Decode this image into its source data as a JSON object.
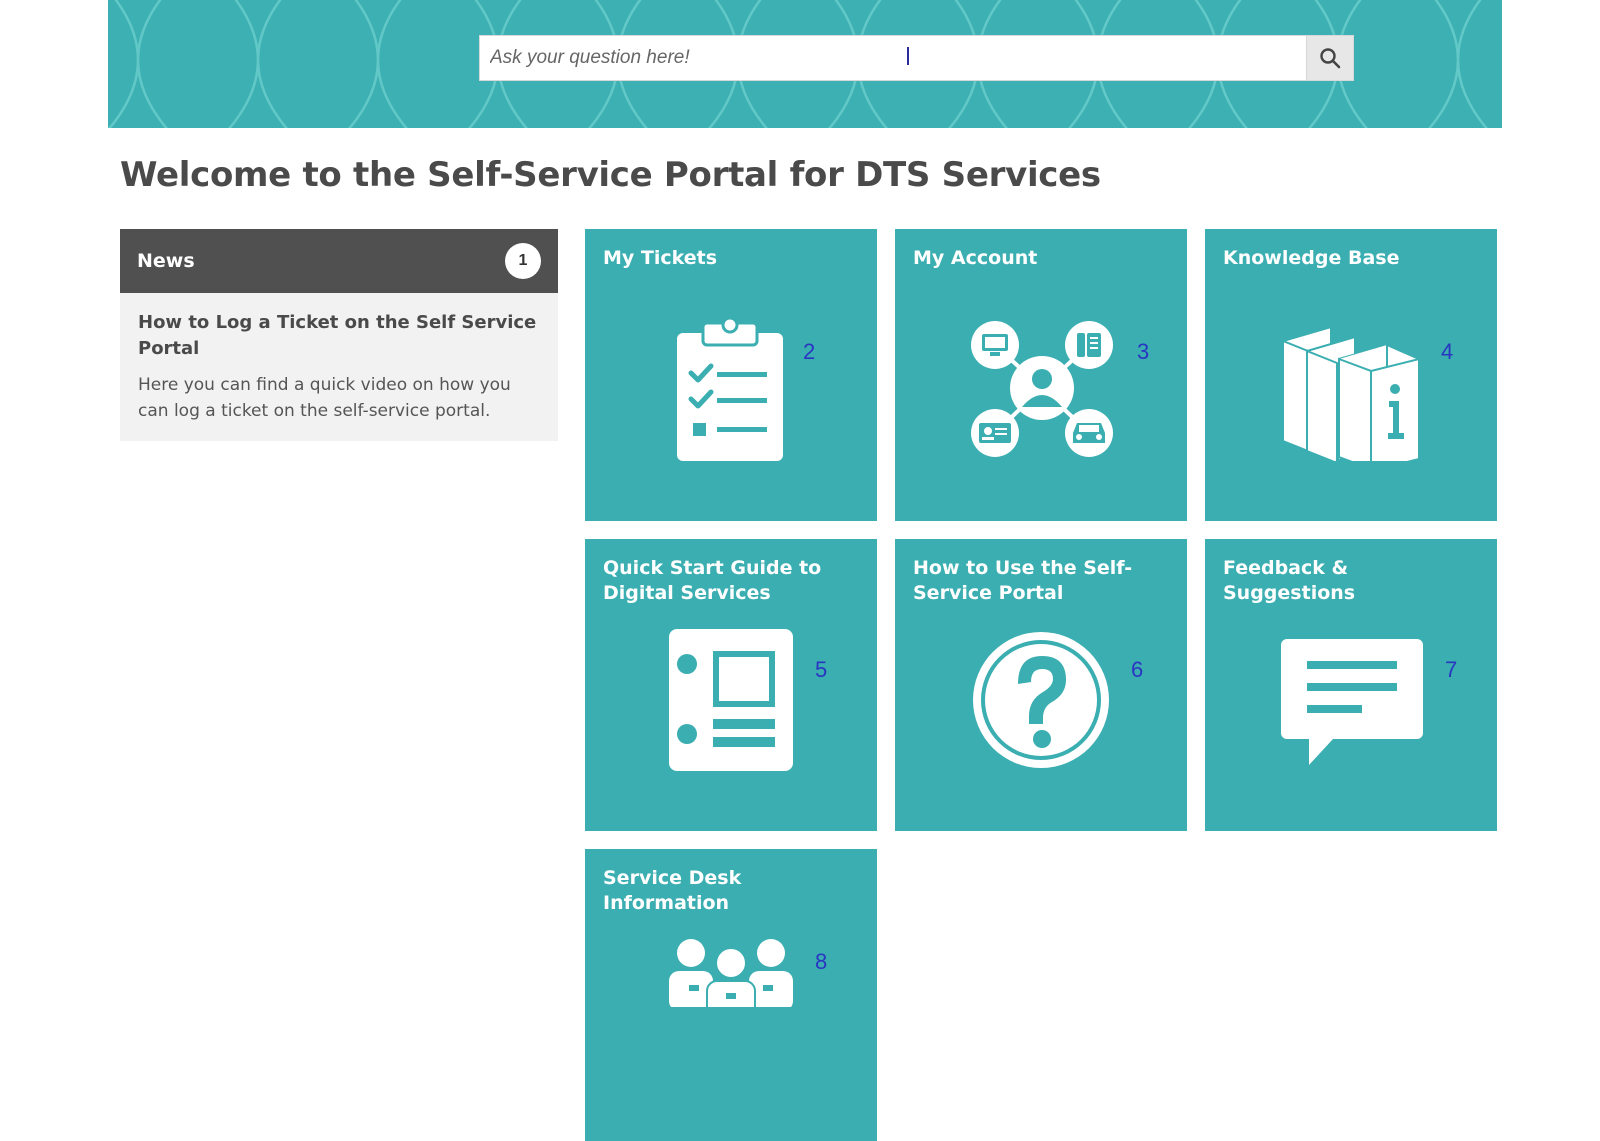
{
  "search": {
    "placeholder": "Ask your question here!"
  },
  "page": {
    "title": "Welcome to the Self-Service Portal for DTS Services"
  },
  "news": {
    "title": "News",
    "count": "1",
    "items": [
      {
        "title": "How to Log a Ticket on the Self Service Portal",
        "description": "Here you can find a quick video on how you can log a ticket on the self-service portal."
      }
    ]
  },
  "tiles": [
    {
      "title": "My Tickets",
      "number": "2",
      "icon": "clipboard-checklist-icon"
    },
    {
      "title": "My Account",
      "number": "3",
      "icon": "account-network-icon"
    },
    {
      "title": "Knowledge Base",
      "number": "4",
      "icon": "info-books-icon"
    },
    {
      "title": "Quick Start Guide to Digital Services",
      "number": "5",
      "icon": "binder-guide-icon"
    },
    {
      "title": "How to Use the Self-Service Portal",
      "number": "6",
      "icon": "question-mark-icon"
    },
    {
      "title": "Feedback & Suggestions",
      "number": "7",
      "icon": "speech-bubble-icon"
    },
    {
      "title": "Service Desk Information",
      "number": "8",
      "icon": "team-people-icon"
    }
  ],
  "colors": {
    "banner": "#3cb0b2",
    "tile": "#3aaeb0",
    "news_header": "#505050",
    "annotation_number": "#2a36c2"
  }
}
